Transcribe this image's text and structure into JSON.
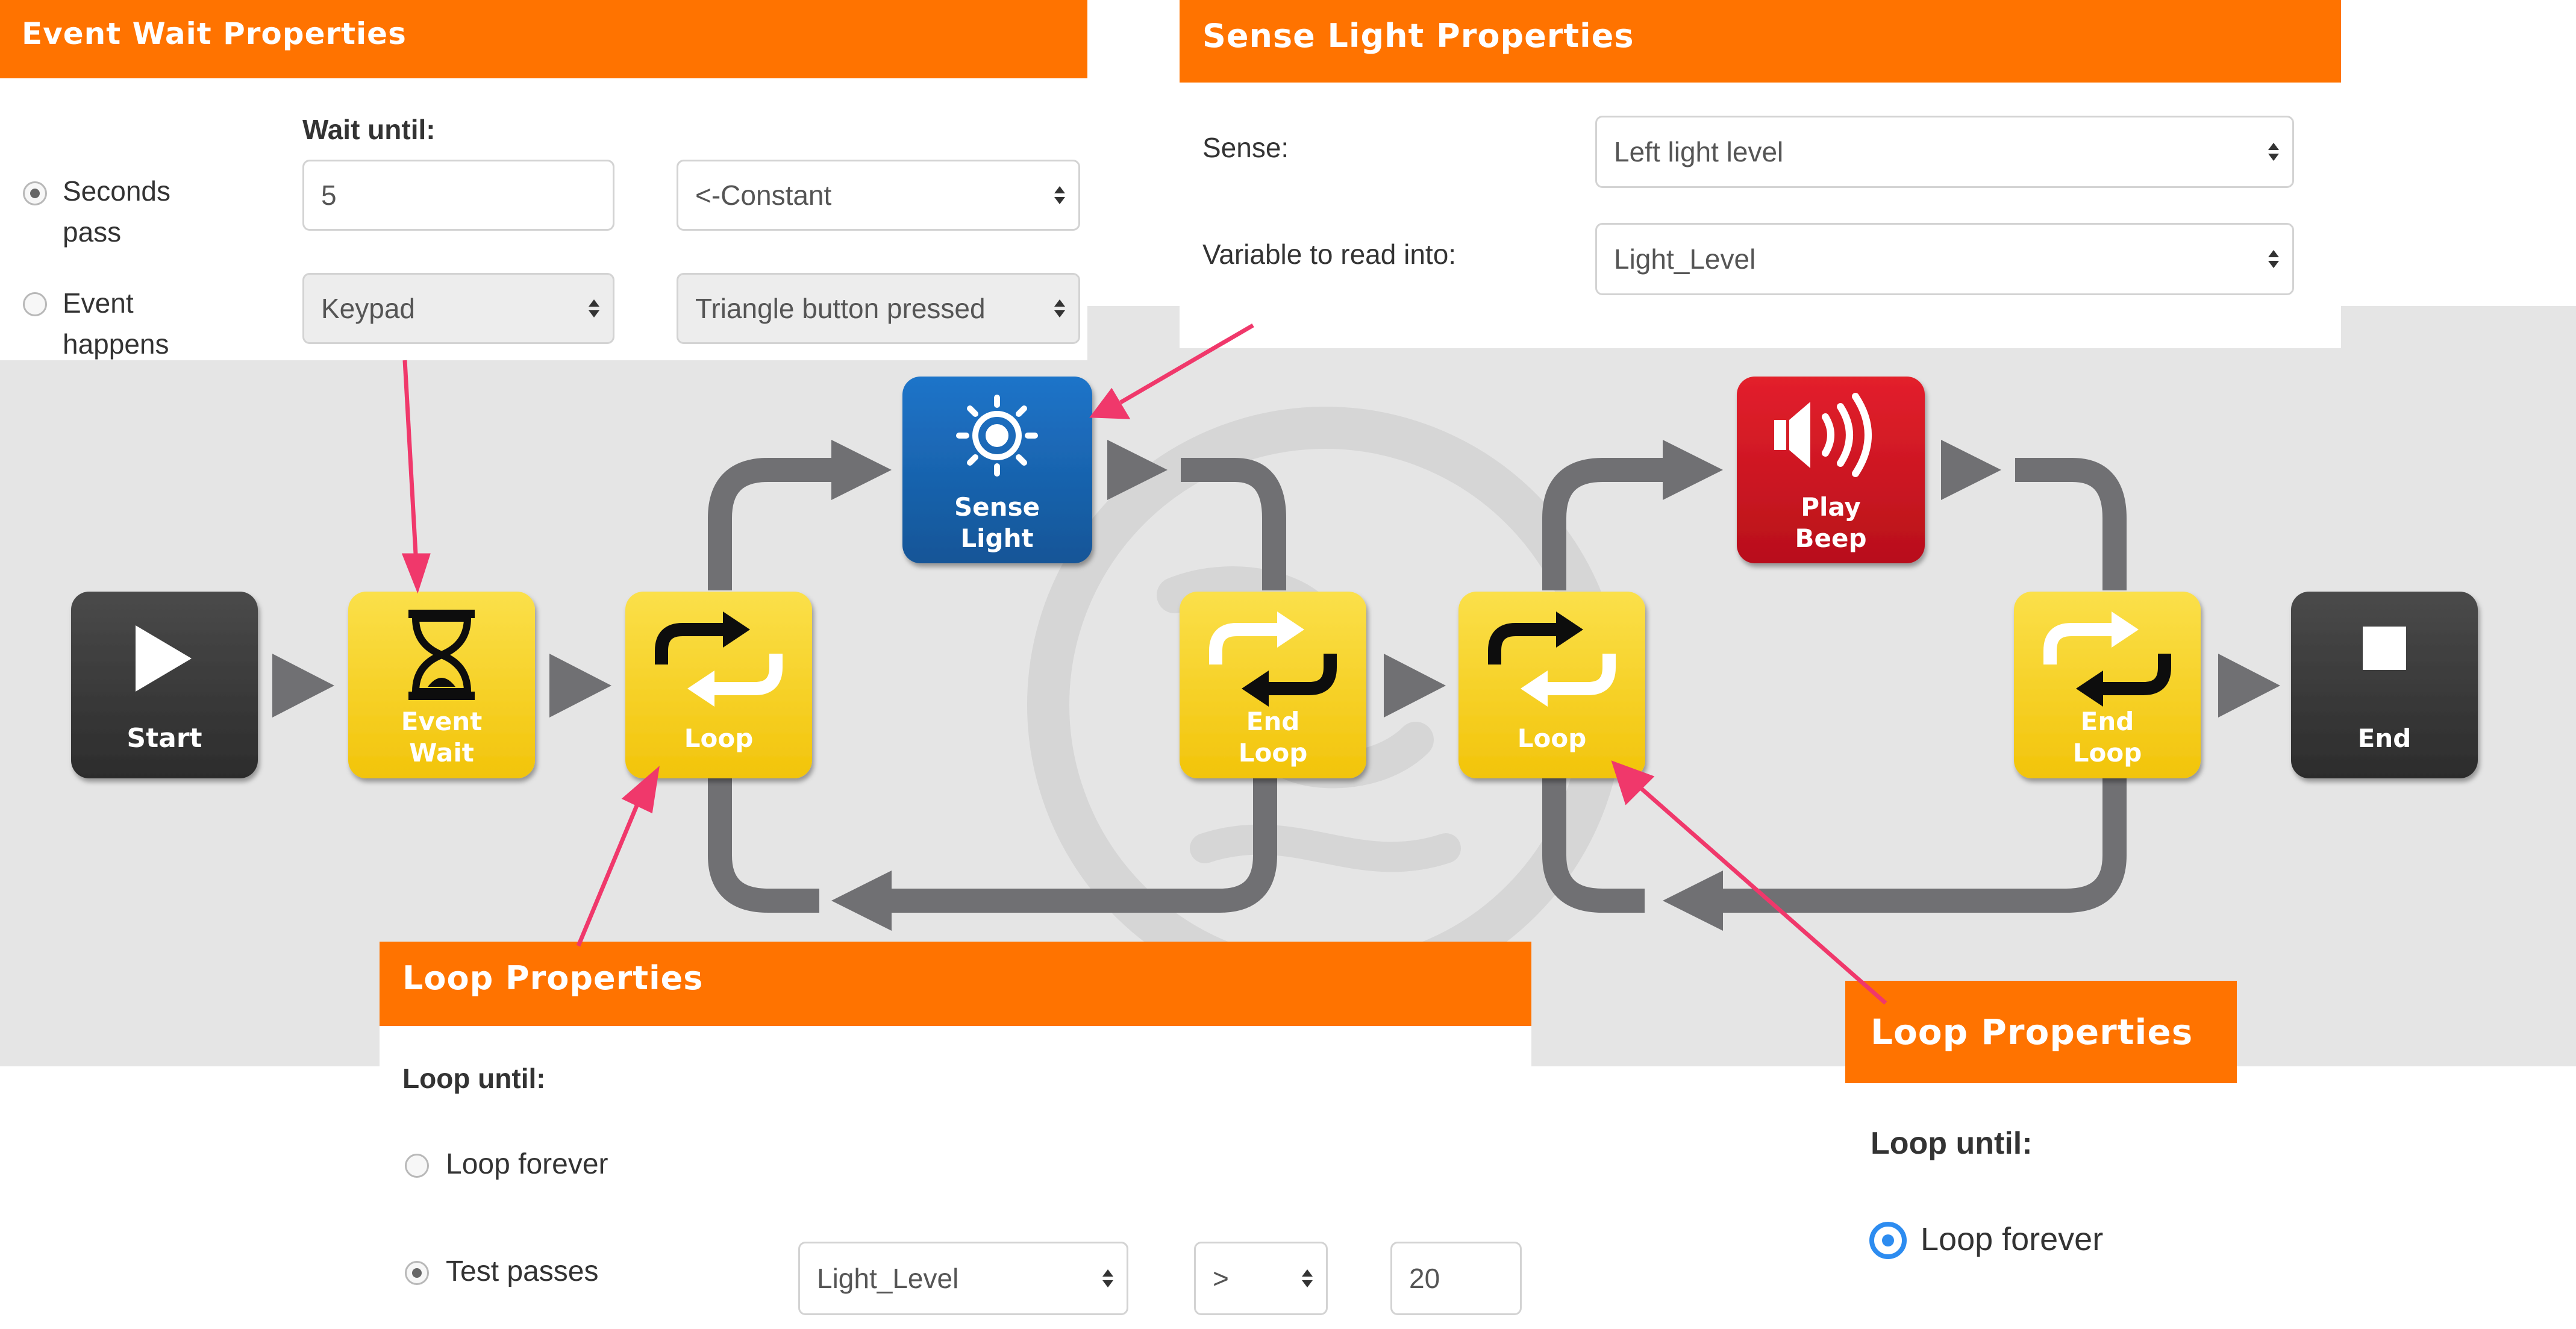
{
  "event_wait_panel": {
    "title": "Event Wait Properties",
    "wait_until_label": "Wait until:",
    "option_seconds": {
      "label_line1": "Seconds",
      "label_line2": "pass",
      "selected": true
    },
    "option_event": {
      "label_line1": "Event",
      "label_line2": "happens",
      "selected": false
    },
    "seconds_value": "5",
    "seconds_source": "<-Constant",
    "event_source": "Keypad",
    "event_type": "Triangle button pressed"
  },
  "sense_light_panel": {
    "title": "Sense Light Properties",
    "sense_label": "Sense:",
    "sense_value": "Left light level",
    "variable_label": "Variable to read into:",
    "variable_value": "Light_Level"
  },
  "loop_panel_1": {
    "title": "Loop Properties",
    "loop_until_label": "Loop until:",
    "option_forever": {
      "label": "Loop forever",
      "selected": false
    },
    "option_test": {
      "label": "Test passes",
      "selected": true
    },
    "test_variable": "Light_Level",
    "test_operator": ">",
    "test_value": "20"
  },
  "loop_panel_2": {
    "title": "Loop Properties",
    "loop_until_label": "Loop until:",
    "option_forever": {
      "label": "Loop forever",
      "selected": true
    }
  },
  "blocks": {
    "start": "Start",
    "event_wait": [
      "Event",
      "Wait"
    ],
    "loop1": "Loop",
    "sense_light": [
      "Sense",
      "Light"
    ],
    "end_loop1": [
      "End",
      "Loop"
    ],
    "loop2": "Loop",
    "play_beep": [
      "Play",
      "Beep"
    ],
    "end_loop2": [
      "End",
      "Loop"
    ],
    "end": "End"
  },
  "colors": {
    "header_orange": "#ff7300",
    "block_yellow": "#f5cf0f",
    "block_dark": "#3a3a3a",
    "block_blue": "#1a62b0",
    "block_red": "#d0121e",
    "connector_grey": "#707073",
    "pointer_pink": "#f0386b",
    "radio_blue": "#2d8cf0"
  }
}
